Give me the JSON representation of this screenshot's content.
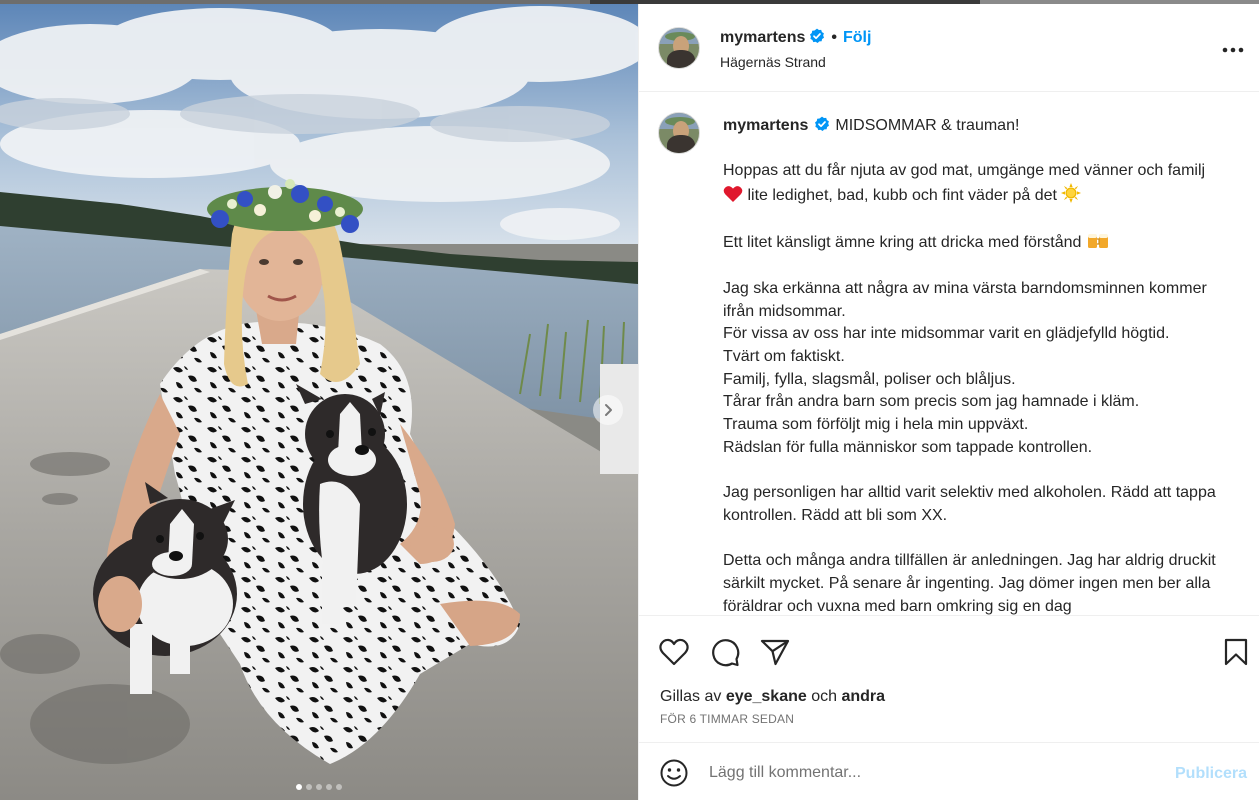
{
  "post": {
    "username": "mymartens",
    "follow_label": "Följ",
    "separator": "•",
    "location": "Hägernäs Strand"
  },
  "caption": {
    "title": "MIDSOMMAR & trauman!",
    "p1_a": "Hoppas att du får njuta av god mat, umgänge med vänner och familj",
    "p1_b": "lite ledighet, bad, kubb och fint väder på det",
    "p2": "Ett litet känsligt ämne kring att dricka med förstånd",
    "p3_lines": [
      "Jag ska erkänna att några av mina värsta barndomsminnen kommer ifrån midsommar.",
      "För vissa av oss har inte midsommar varit en glädjefylld högtid.",
      "Tvärt om faktiskt.",
      "Familj, fylla, slagsmål, poliser och blåljus.",
      "Tårar från andra barn som precis som jag hamnade i kläm.",
      "Trauma som förföljt mig i hela min uppväxt.",
      "Rädslan för fulla människor som tappade kontrollen."
    ],
    "p4": "Jag personligen har alltid varit selektiv med alkoholen. Rädd att tappa kontrollen. Rädd att bli som XX.",
    "p5": "Detta och många andra tillfällen är anledningen. Jag har aldrig druckit särkilt mycket. På senare år ingenting. Jag dömer ingen men ber alla föräldrar och vuxna med barn omkring sig en dag"
  },
  "icons": {
    "verified": "verified-badge-icon",
    "more": "more-options-icon",
    "like": "heart-icon",
    "comment": "comment-icon",
    "share": "share-icon",
    "save": "bookmark-icon",
    "emoji": "emoji-icon",
    "next": "chevron-right-icon",
    "heart_emoji": "red-heart-emoji",
    "sun_emoji": "sun-emoji",
    "beer_emoji": "beer-emoji"
  },
  "engagement": {
    "liked_by_prefix": "Gillas av",
    "liked_by_user": "eye_skane",
    "and_label": "och",
    "others_label": "andra",
    "time_ago": "FÖR 6 TIMMAR SEDAN"
  },
  "comment": {
    "placeholder": "Lägg till kommentar...",
    "publish_label": "Publicera"
  },
  "carousel": {
    "slide_count": 5,
    "active_index": 0
  },
  "colors": {
    "accent": "#0095f6",
    "verified": "#0095f6",
    "publish_disabled": "#b2dffc",
    "muted": "#737373",
    "border": "#efefef"
  }
}
